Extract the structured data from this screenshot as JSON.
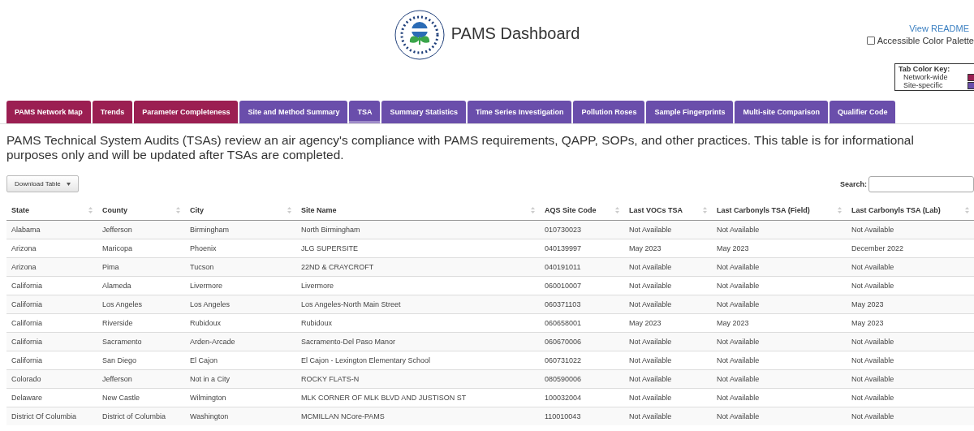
{
  "header": {
    "title": "PAMS Dashboard",
    "readme_link": "View README",
    "accessible_palette": {
      "label": "Accessible Color Palette",
      "checked": false
    }
  },
  "color_key": {
    "title": "Tab Color Key:",
    "items": [
      {
        "label": "Network-wide",
        "color": "#9b1f52"
      },
      {
        "label": "Site-specific",
        "color": "#6a4eab"
      }
    ]
  },
  "tabs": [
    {
      "label": "PAMS Network Map",
      "kind": "network",
      "selected": false
    },
    {
      "label": "Trends",
      "kind": "network",
      "selected": false
    },
    {
      "label": "Parameter Completeness",
      "kind": "network",
      "selected": false
    },
    {
      "label": "Site and Method Summary",
      "kind": "site",
      "selected": false
    },
    {
      "label": "TSA",
      "kind": "site",
      "selected": true
    },
    {
      "label": "Summary Statistics",
      "kind": "site",
      "selected": false
    },
    {
      "label": "Time Series Investigation",
      "kind": "site",
      "selected": false
    },
    {
      "label": "Pollution Roses",
      "kind": "site",
      "selected": false
    },
    {
      "label": "Sample Fingerprints",
      "kind": "site",
      "selected": false
    },
    {
      "label": "Multi-site Comparison",
      "kind": "site",
      "selected": false
    },
    {
      "label": "Qualifier Code",
      "kind": "site",
      "selected": false
    }
  ],
  "description": "PAMS Technical System Audits (TSAs) review an air agency's compliance with PAMS requirements, QAPP, SOPs, and other practices. This table is for informational purposes only and will be updated after TSAs are completed.",
  "download_button": "Download Table",
  "search": {
    "label": "Search:"
  },
  "table": {
    "columns": [
      "State",
      "County",
      "City",
      "Site Name",
      "AQS Site Code",
      "Last VOCs TSA",
      "Last Carbonyls TSA (Field)",
      "Last Carbonyls TSA (Lab)"
    ],
    "rows": [
      [
        "Alabama",
        "Jefferson",
        "Birmingham",
        "North Birmingham",
        "010730023",
        "Not Available",
        "Not Available",
        "Not Available"
      ],
      [
        "Arizona",
        "Maricopa",
        "Phoenix",
        "JLG SUPERSITE",
        "040139997",
        "May 2023",
        "May 2023",
        "December 2022"
      ],
      [
        "Arizona",
        "Pima",
        "Tucson",
        "22ND & CRAYCROFT",
        "040191011",
        "Not Available",
        "Not Available",
        "Not Available"
      ],
      [
        "California",
        "Alameda",
        "Livermore",
        "Livermore",
        "060010007",
        "Not Available",
        "Not Available",
        "Not Available"
      ],
      [
        "California",
        "Los Angeles",
        "Los Angeles",
        "Los Angeles-North Main Street",
        "060371103",
        "Not Available",
        "Not Available",
        "May 2023"
      ],
      [
        "California",
        "Riverside",
        "Rubidoux",
        "Rubidoux",
        "060658001",
        "May 2023",
        "May 2023",
        "May 2023"
      ],
      [
        "California",
        "Sacramento",
        "Arden-Arcade",
        "Sacramento-Del Paso Manor",
        "060670006",
        "Not Available",
        "Not Available",
        "Not Available"
      ],
      [
        "California",
        "San Diego",
        "El Cajon",
        "El Cajon - Lexington Elementary School",
        "060731022",
        "Not Available",
        "Not Available",
        "Not Available"
      ],
      [
        "Colorado",
        "Jefferson",
        "Not in a City",
        "ROCKY FLATS-N",
        "080590006",
        "Not Available",
        "Not Available",
        "Not Available"
      ],
      [
        "Delaware",
        "New Castle",
        "Wilmington",
        "MLK CORNER OF MLK BLVD AND JUSTISON ST",
        "100032004",
        "Not Available",
        "Not Available",
        "Not Available"
      ],
      [
        "District Of Columbia",
        "District of Columbia",
        "Washington",
        "MCMILLAN NCore-PAMS",
        "110010043",
        "Not Available",
        "Not Available",
        "Not Available"
      ]
    ]
  }
}
